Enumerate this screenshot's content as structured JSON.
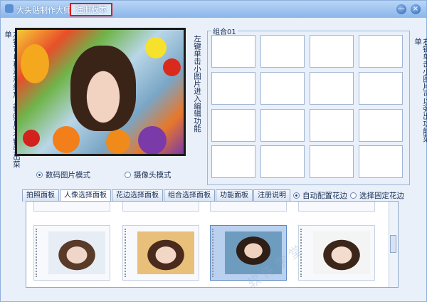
{
  "window": {
    "title": "大头贴制作大师",
    "register_tab": "注册版本",
    "minimize": "—",
    "close": "×"
  },
  "left_hint": "左键可以移动和缩放人物照片,右键弹出菜单",
  "middle_hint": "左键单击小图片进入编辑功能",
  "right_hint": "右键单击小图片可以弹出功能菜单",
  "capture_modes": {
    "digital": "数码图片模式",
    "camera": "摄像头模式",
    "selected": "digital"
  },
  "group": {
    "label": "组合01"
  },
  "tabs": [
    {
      "label": "拍照面板"
    },
    {
      "label": "人像选择面板"
    },
    {
      "label": "花边选择面板"
    },
    {
      "label": "组合选择面板"
    },
    {
      "label": "功能面板"
    },
    {
      "label": "注册说明"
    }
  ],
  "active_tab": 1,
  "frame_options": {
    "auto": "自动配置花边",
    "fixed": "选择固定花边",
    "selected": "auto"
  },
  "watermark": "软 件 学 堂",
  "colors": {
    "accent": "#2f66b4",
    "highlight": "#e01a1a"
  }
}
